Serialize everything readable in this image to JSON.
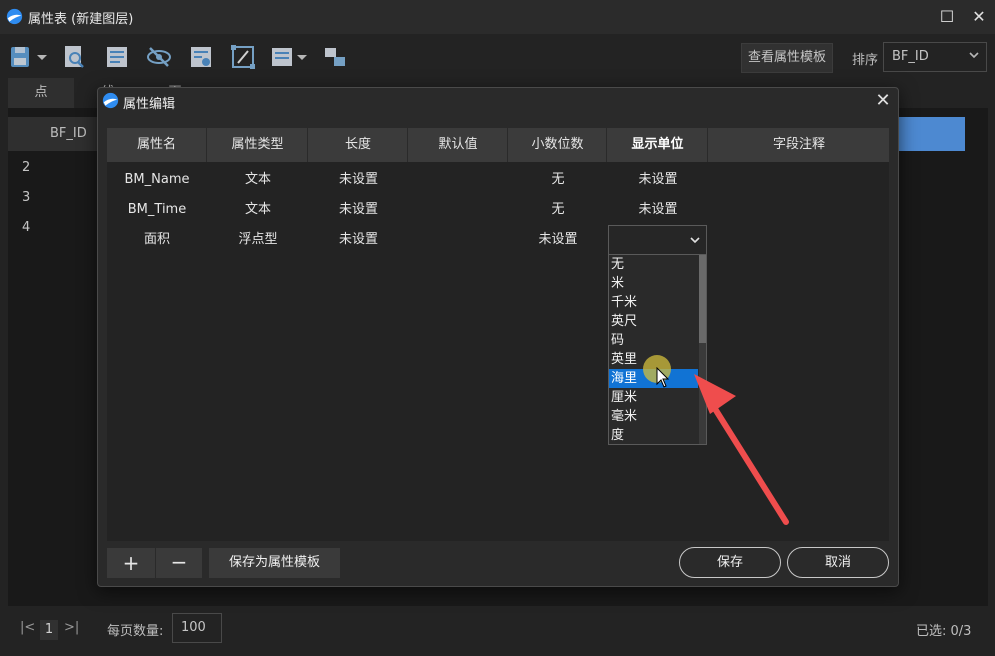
{
  "window": {
    "title": "属性表 (新建图层)",
    "controls": {
      "maximize": "☐",
      "close": "✕"
    }
  },
  "toolbar": {
    "view_template_label": "查看属性模板",
    "sort_label": "排序",
    "sort_value": "BF_ID",
    "icons": [
      "save-icon",
      "find-icon",
      "table-edit-icon",
      "hide-icon",
      "form-icon",
      "field-calc-icon",
      "view-menu-icon",
      "relation-icon"
    ]
  },
  "geo_tabs": [
    "点",
    "线",
    "面"
  ],
  "table": {
    "column": "BF_ID",
    "rows": [
      "2",
      "3",
      "4"
    ]
  },
  "status": {
    "page_first": "|<",
    "page": "1",
    "page_last": ">|",
    "per_page_label": "每页数量:",
    "per_page_value": "100",
    "selected": "已选: 0/3"
  },
  "dialog": {
    "title": "属性编辑",
    "close": "✕",
    "columns": [
      "属性名",
      "属性类型",
      "长度",
      "默认值",
      "小数位数",
      "显示单位",
      "字段注释"
    ],
    "rows": [
      {
        "name": "BM_Name",
        "type": "文本",
        "length": "未设置",
        "default": "",
        "decimals": "无",
        "unit": "未设置",
        "note": ""
      },
      {
        "name": "BM_Time",
        "type": "文本",
        "length": "未设置",
        "default": "",
        "decimals": "无",
        "unit": "未设置",
        "note": ""
      },
      {
        "name": "面积",
        "type": "浮点型",
        "length": "未设置",
        "default": "",
        "decimals": "未设置",
        "unit": "",
        "note": ""
      }
    ],
    "unit_options": [
      "无",
      "米",
      "千米",
      "英尺",
      "码",
      "英里",
      "海里",
      "厘米",
      "毫米",
      "度"
    ],
    "unit_selected_index": 6,
    "add_label": "+",
    "remove_label": "−",
    "save_template_label": "保存为属性模板",
    "save_label": "保存",
    "cancel_label": "取消"
  },
  "colors": {
    "accent": "#1173d4",
    "header_selected": "#5ea8ff",
    "annotation_arrow": "#ef4d4d",
    "background": "#2b2b2b"
  }
}
